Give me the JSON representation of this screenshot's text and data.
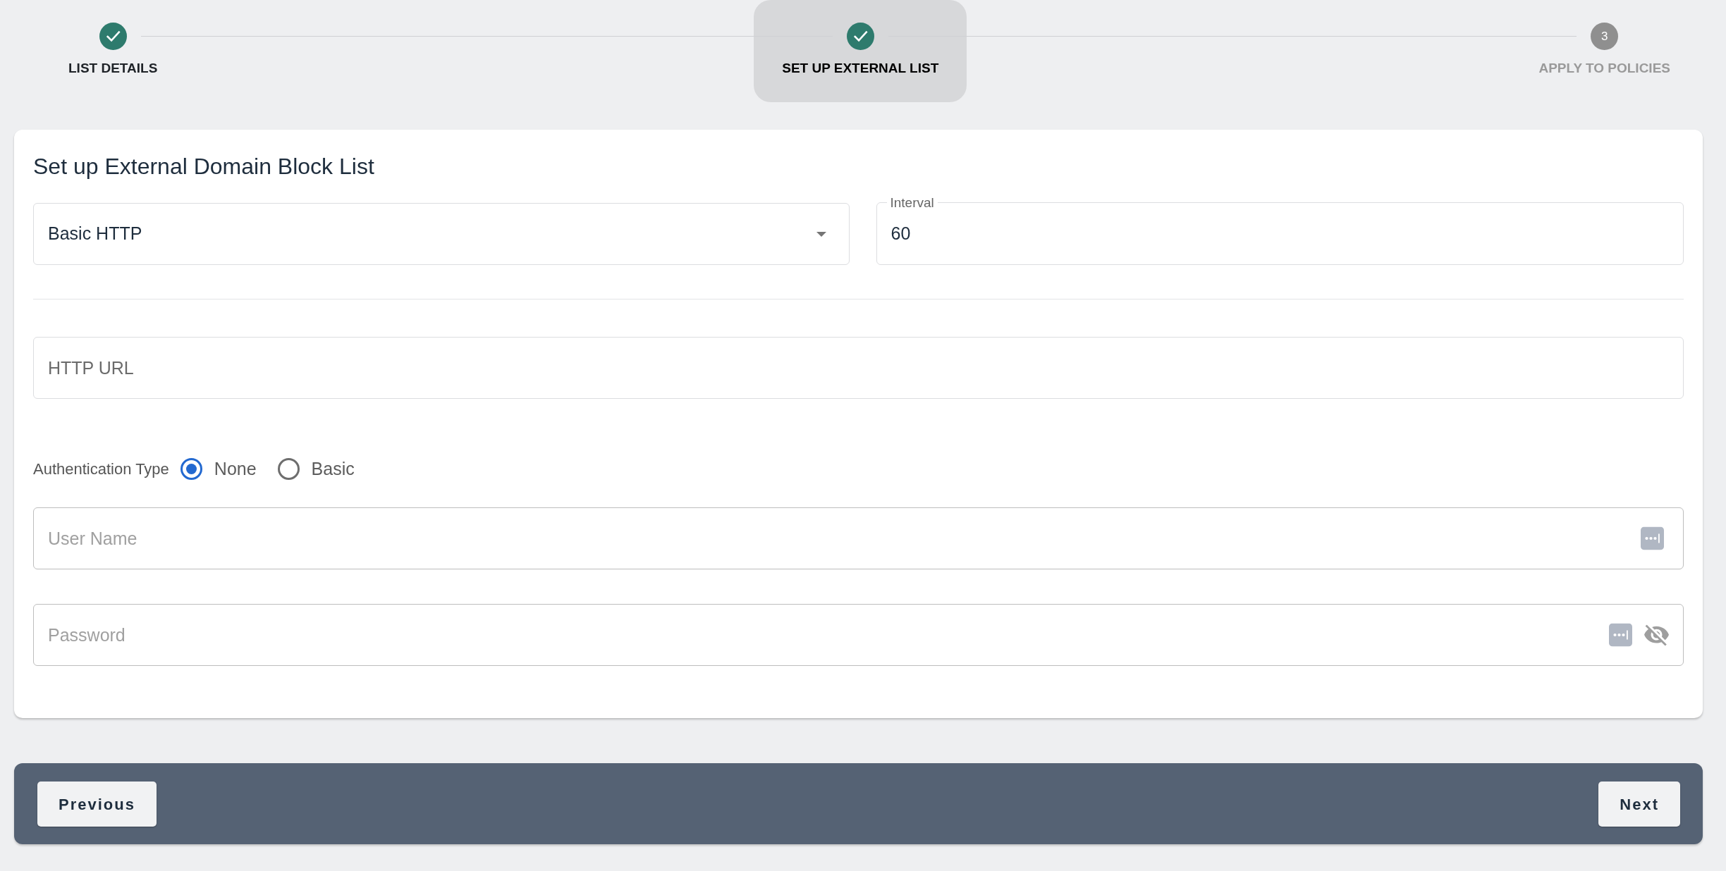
{
  "stepper": {
    "steps": [
      {
        "label": "LIST DETAILS",
        "completed": true,
        "selected": false
      },
      {
        "label": "SET UP EXTERNAL LIST",
        "completed": true,
        "selected": true
      },
      {
        "label": "APPLY TO POLICIES",
        "number": "3",
        "completed": false,
        "selected": false
      }
    ]
  },
  "form": {
    "title": "Set up External Domain Block List",
    "source_type": {
      "value": "Basic HTTP"
    },
    "interval": {
      "label": "Interval",
      "value": "60"
    },
    "http_url": {
      "placeholder": "HTTP URL"
    },
    "authentication": {
      "label": "Authentication Type",
      "options": [
        {
          "label": "None",
          "selected": true
        },
        {
          "label": "Basic",
          "selected": false
        }
      ]
    },
    "user_name": {
      "placeholder": "User Name"
    },
    "password": {
      "placeholder": "Password"
    }
  },
  "footer": {
    "buttons": [
      {
        "label": "Previous"
      },
      {
        "label": "Next"
      }
    ]
  }
}
